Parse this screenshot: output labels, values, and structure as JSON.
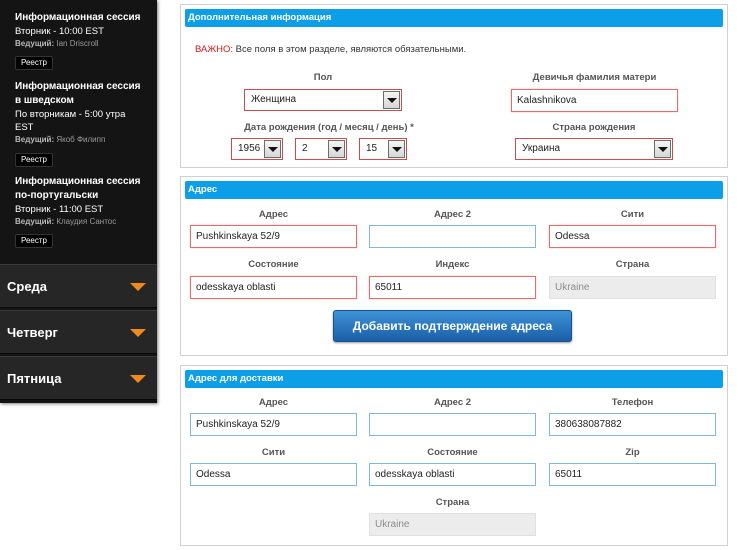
{
  "sidebar": {
    "sessions": [
      {
        "title_line1": "Информационная сессия",
        "title_line2": "",
        "time_line1": "Вторник - 10:00 EST",
        "time_line2": "",
        "host_label": "Ведущий:",
        "host_name": "Ian Driscroll",
        "register_label": "Реестр"
      },
      {
        "title_line1": "Информационная сессия",
        "title_line2": "в шведском",
        "time_line1": "По вторникам - 5:00 утра",
        "time_line2": "EST",
        "host_label": "Ведущий:",
        "host_name": "Якоб Филипп",
        "register_label": "Реестр"
      },
      {
        "title_line1": "Информационная сессия",
        "title_line2": "по-португальски",
        "time_line1": "Вторник - 11:00 EST",
        "time_line2": "",
        "host_label": "Ведущий:",
        "host_name": "Клаудия Сантос",
        "register_label": "Реестр"
      }
    ],
    "days": [
      "Среда",
      "Четверг",
      "Пятница"
    ]
  },
  "additional_info": {
    "header": "Дополнительная информация",
    "notice_important": "ВАЖНО:",
    "notice_text": " Все поля в этом разделе, являются обязательными.",
    "gender_label": "Пол",
    "gender_value": "Женщина",
    "maiden_label": "Девичья фамилия матери",
    "maiden_value": "Kalashnikova",
    "dob_label": "Дата рождения (год / месяц / день) *",
    "dob_year": "1956",
    "dob_month": "2",
    "dob_day": "15",
    "birth_country_label": "Страна рождения",
    "birth_country_value": "Украина"
  },
  "address": {
    "header": "Адрес",
    "address_label": "Адрес",
    "address_value": "Pushkinskaya 52/9",
    "address2_label": "Адрес 2",
    "address2_value": "",
    "city_label": "Сити",
    "city_value": "Odessa",
    "state_label": "Состояние",
    "state_value": "odesskaya oblasti",
    "zip_label": "Индекс",
    "zip_value": "65011",
    "country_label": "Страна",
    "country_value": "Ukraine",
    "confirm_button": "Добавить подтверждение адреса"
  },
  "shipping": {
    "header": "Адрес для доставки",
    "address_label": "Адрес",
    "address_value": "Pushkinskaya 52/9",
    "address2_label": "Адрес 2",
    "address2_value": "",
    "phone_label": "Телефон",
    "phone_value": "380638087882",
    "city_label": "Сити",
    "city_value": "Odessa",
    "state_label": "Состояние",
    "state_value": "odesskaya oblasti",
    "zip_label": "Zip",
    "zip_value": "65011",
    "country_label": "Страна",
    "country_value": "Ukraine"
  }
}
